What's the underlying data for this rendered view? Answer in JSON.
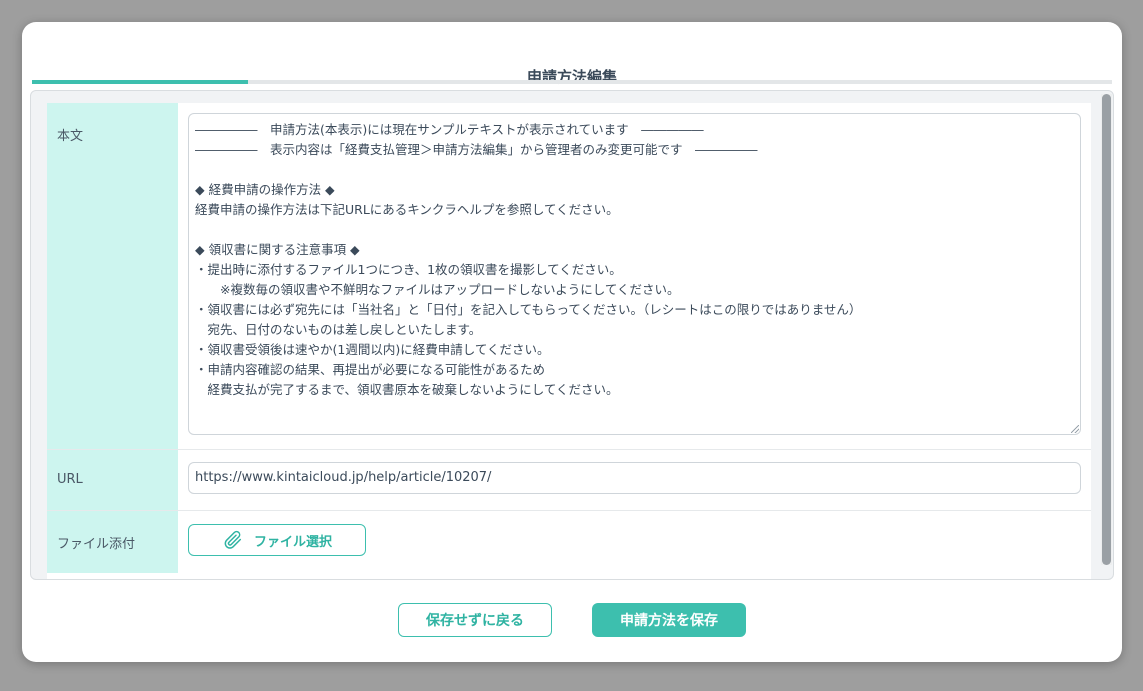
{
  "dialog": {
    "title": "申請方法編集"
  },
  "form": {
    "body_label": "本文",
    "body_text": "―――――　申請方法(本表示)には現在サンプルテキストが表示されています　―――――\n―――――　表示内容は「経費支払管理＞申請方法編集」から管理者のみ変更可能です　―――――\n\n◆ 経費申請の操作方法 ◆\n経費申請の操作方法は下記URLにあるキンクラヘルプを参照してください。\n\n◆ 領収書に関する注意事項 ◆\n・提出時に添付するファイル1つにつき、1枚の領収書を撮影してください。\n　　※複数毎の領収書や不鮮明なファイルはアップロードしないようにしてください。\n・領収書には必ず宛先には「当社名」と「日付」を記入してもらってください。（レシートはこの限りではありません）\n　宛先、日付のないものは差し戻しといたします。\n・領収書受領後は速やか(1週間以内)に経費申請してください。\n・申請内容確認の結果、再提出が必要になる可能性があるため\n　経費支払が完了するまで、領収書原本を破棄しないようにしてください。",
    "url_label": "URL",
    "url_value": "https://www.kintaicloud.jp/help/article/10207/",
    "file_label": "ファイル添付",
    "file_button": "ファイル選択"
  },
  "footer": {
    "back_button": "保存せずに戻る",
    "save_button": "申請方法を保存"
  },
  "colors": {
    "accent": "#3dbfae",
    "label_bg": "#cdf5ef",
    "text": "#3b4a5a"
  },
  "icons": {
    "file_button_icon": "paperclip-icon"
  }
}
